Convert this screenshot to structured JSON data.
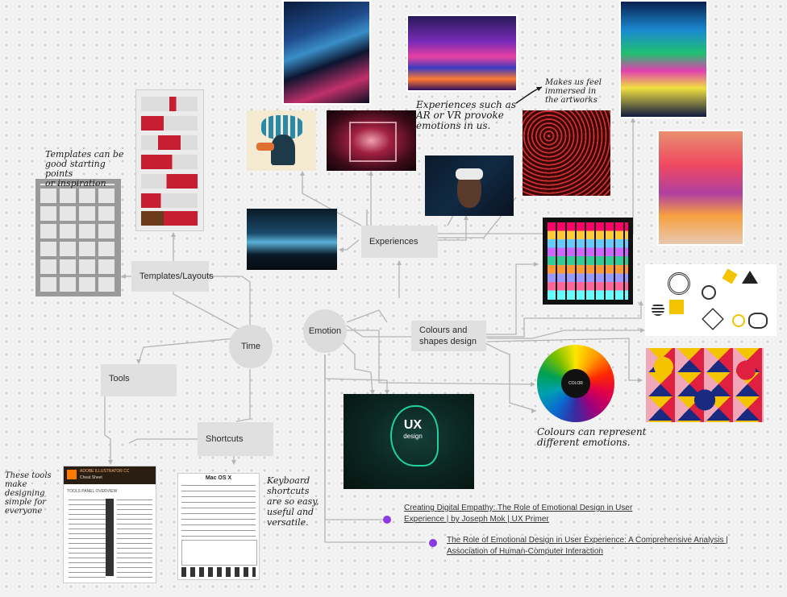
{
  "nodes": {
    "experiences": "Experiences",
    "templates": "Templates/Layouts",
    "time": "Time",
    "emotion": "Emotion",
    "colours_line1": "Colours and",
    "colours_line2": "shapes design",
    "tools": "Tools",
    "shortcuts": "Shortcuts"
  },
  "notes": {
    "templates": "Templates can be\ngood starting points\nor inspiration",
    "experiences": "Experiences such as\nAR or VR provoke\nemotions in us.",
    "immersed": "Makes us feel\nimmersed in\nthe artworks",
    "colours": "Colours can represent\ndifferent emotions.",
    "tools": "These tools\nmake designing\nsimple for\neveryone",
    "keyboard": "Keyboard\nshortcuts\nare so easy,\nuseful and\nversatile."
  },
  "links": {
    "link1_line1": "Creating Digital Empathy: The Role of Emotional Design in User",
    "link1_line2": "Experience | by Joseph Mok | UX Primer",
    "link2_line1": "The Role of Emotional Design in User Experience: A Comprehensive Analysis |",
    "link2_line2": "Association of Human-Computer Interaction"
  },
  "cards": {
    "ux_title": "UX",
    "ux_sub": "design",
    "mac_title": "Mac OS X",
    "illustrator_title": "ADOBE ILLUSTRATOR CC",
    "illustrator_sub": "Cheat Sheet",
    "illustrator_section": "TOOLS PANEL OVERVIEW",
    "wheel_center": "COLOR"
  },
  "colors": {
    "node_bg": "#e0e0e0",
    "line": "#b5b5b5",
    "link_dot": "#8a3be0",
    "canvas": "#f2f2f2"
  }
}
